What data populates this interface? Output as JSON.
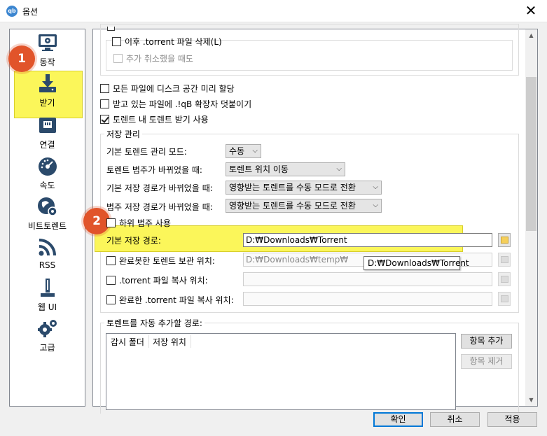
{
  "window": {
    "title": "옵션",
    "app_icon": "qb",
    "close_glyph": "✕"
  },
  "sidebar": {
    "items": [
      {
        "label": "동작",
        "icon": "behavior-icon"
      },
      {
        "label": "받기",
        "icon": "download-icon",
        "selected": true
      },
      {
        "label": "연결",
        "icon": "connection-icon"
      },
      {
        "label": "속도",
        "icon": "speed-icon"
      },
      {
        "label": "비트토렌트",
        "icon": "bittorrent-icon"
      },
      {
        "label": "RSS",
        "icon": "rss-icon"
      },
      {
        "label": "웹 UI",
        "icon": "webui-icon"
      },
      {
        "label": "고급",
        "icon": "advanced-icon"
      }
    ]
  },
  "badges": {
    "first": "1",
    "second": "2"
  },
  "torrent_files": {
    "delete_after_label": "이후 .torrent 파일 삭제(L)",
    "delete_after_checked": false,
    "also_when_cancelled_label": "추가 취소했을 때도",
    "also_when_cancelled_checked": false
  },
  "options": {
    "preallocate_label": "모든 파일에 디스크 공간 미리 할당",
    "preallocate_checked": false,
    "append_ext_label": "받고 있는 파일에 .!qB 확장자 덧붙이기",
    "append_ext_checked": false,
    "recursive_label": "토렌트 내 토렌트 받기 사용",
    "recursive_checked": true
  },
  "saving": {
    "group_title": "저장 관리",
    "default_mode_label": "기본 토렌트 관리 모드:",
    "default_mode_value": "수동",
    "category_changed_label": "토렌트 범주가 바뀌었을 때:",
    "category_changed_value": "토렌트 위치 이동",
    "default_path_changed_label": "기본 저장 경로가 바뀌었을 때:",
    "default_path_changed_value": "영향받는 토렌트를 수동 모드로 전환",
    "category_path_changed_label": "범주 저장 경로가 바뀌었을 때:",
    "category_path_changed_value": "영향받는 토렌트를 수동 모드로 전환",
    "subcategories_label": "하위 범주 사용",
    "subcategories_checked": false,
    "default_save_path_label": "기본 저장 경로:",
    "default_save_path_value": "D:₩Downloads₩Torrent",
    "incomplete_label": "완료못한 토렌트 보관 위치:",
    "incomplete_checked": false,
    "incomplete_value": "D:₩Downloads₩temp₩",
    "copy_torrent_label": ".torrent 파일 복사 위치:",
    "copy_torrent_checked": false,
    "copy_finished_label": "완료한 .torrent 파일 복사 위치:",
    "copy_finished_checked": false
  },
  "tooltip": {
    "text": "D:₩Downloads₩Torrent"
  },
  "watch": {
    "group_title": "토렌트를 자동 추가할 경로:",
    "col_folder": "감시 폴더",
    "col_save": "저장 위치",
    "add_label": "항목 추가",
    "remove_label": "항목 제거"
  },
  "footer": {
    "ok": "확인",
    "cancel": "취소",
    "apply": "적용"
  },
  "colors": {
    "highlight": "#fbf65a",
    "badge": "#e1542a",
    "accent": "#0078d7"
  }
}
